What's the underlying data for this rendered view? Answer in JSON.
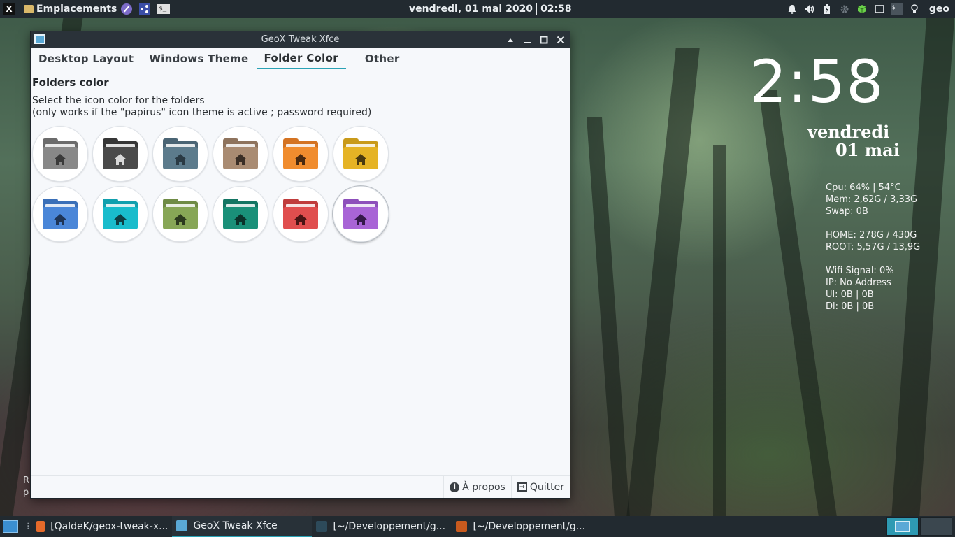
{
  "top_panel": {
    "places_label": "Emplacements",
    "date": "vendredi, 01 mai 2020",
    "time": "02:58",
    "user": "geo",
    "terminal_icon_text": "$_"
  },
  "conky": {
    "time": "2:58",
    "day": "vendredi",
    "date": "01 mai",
    "stats": [
      "Cpu: 64%  | 54°C",
      "Mem: 2,62G / 3,33G",
      "Swap: 0B",
      "",
      "HOME: 278G / 430G",
      "ROOT: 5,57G / 13,9G",
      "",
      "Wifi Signal: 0%",
      "IP: No Address",
      "Ul: 0B | 0B",
      "Dl: 0B | 0B"
    ]
  },
  "window": {
    "title": "GeoX Tweak Xfce",
    "tabs": [
      "Desktop Layout",
      "Windows Theme",
      "Folder Color",
      "Other"
    ],
    "active_tab": 2,
    "section_title": "Folders color",
    "desc_line1": "Select the icon color for the folders",
    "desc_line2": "(only works if the \"papirus\" icon theme is active ; password required)",
    "folder_colors": [
      {
        "name": "grey",
        "main": "#888888",
        "dark": "#6b6b6b",
        "house": "#3a3a3a"
      },
      {
        "name": "black",
        "main": "#4a4a4a",
        "dark": "#363636",
        "house": "#d8d8d8"
      },
      {
        "name": "bluegrey",
        "main": "#5c7b8c",
        "dark": "#4a6474",
        "house": "#2a3a44"
      },
      {
        "name": "brown",
        "main": "#a98b72",
        "dark": "#8e735d",
        "house": "#3a2e26"
      },
      {
        "name": "orange",
        "main": "#f08c2e",
        "dark": "#d47322",
        "house": "#4a2a10"
      },
      {
        "name": "yellow",
        "main": "#e5b325",
        "dark": "#c99a1a",
        "house": "#4a3a10"
      },
      {
        "name": "blue",
        "main": "#4a86d8",
        "dark": "#3a6fb8",
        "house": "#1e3456"
      },
      {
        "name": "cyan",
        "main": "#19bccc",
        "dark": "#11a0ae",
        "house": "#0e3f44"
      },
      {
        "name": "green",
        "main": "#87a656",
        "dark": "#6f8b45",
        "house": "#2c3a1e"
      },
      {
        "name": "teal",
        "main": "#1a9079",
        "dark": "#137563",
        "house": "#0b332b"
      },
      {
        "name": "red",
        "main": "#e04e4e",
        "dark": "#c03c3c",
        "house": "#4a1414"
      },
      {
        "name": "violet",
        "main": "#a864d6",
        "dark": "#8d4fbb",
        "house": "#34194a"
      }
    ],
    "selected_folder": 11,
    "about_label": "À propos",
    "quit_label": "Quitter"
  },
  "desktop_text": [
    "R",
    "p"
  ],
  "taskbar": {
    "tasks": [
      {
        "label": "[QaldeK/geox-tweak-x...",
        "icon_color": "#e56a2a",
        "active": false
      },
      {
        "label": "GeoX Tweak Xfce",
        "icon_color": "#5aa9d6",
        "active": true
      },
      {
        "label": "[~/Developpement/g...",
        "icon_color": "#2d4a5a",
        "active": false
      },
      {
        "label": "[~/Developpement/g...",
        "icon_color": "#c85a1e",
        "active": false
      }
    ]
  },
  "colors": {
    "accent": "#2aa2b5",
    "panel_bg": "#222a30"
  }
}
